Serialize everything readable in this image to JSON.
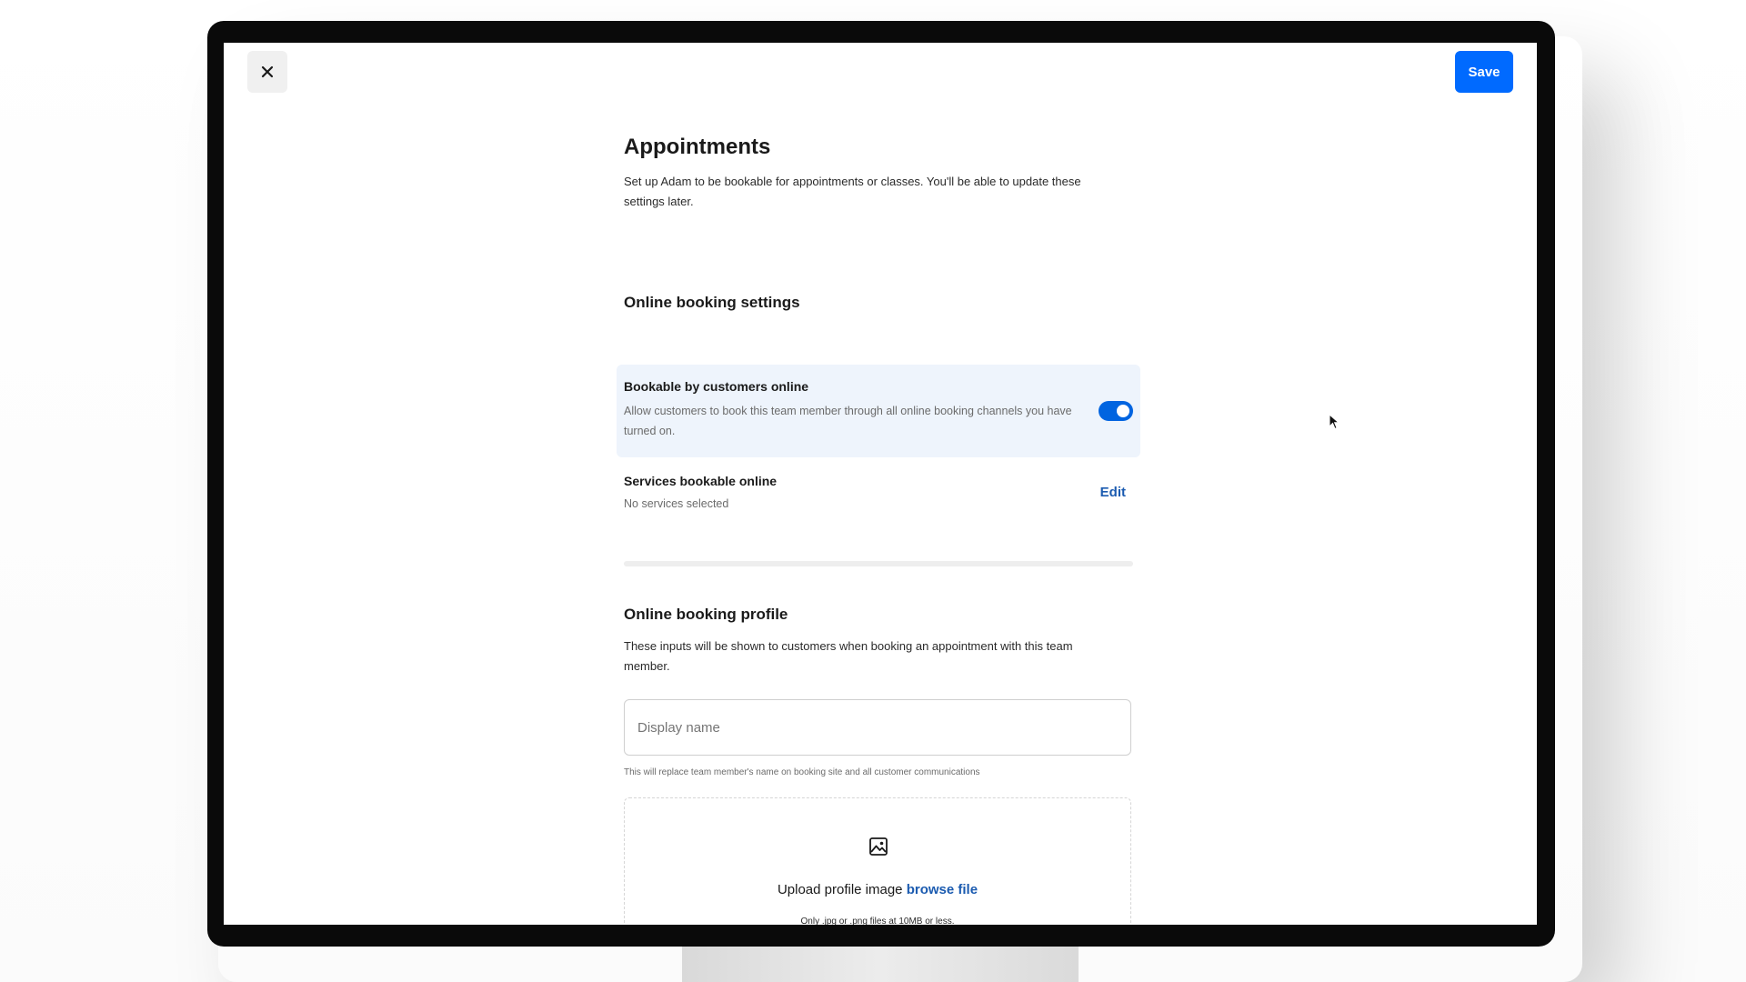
{
  "header": {
    "close_icon": "close-icon",
    "save_label": "Save",
    "save_color": "#006aff"
  },
  "page": {
    "title": "Appointments",
    "description": "Set up Adam to be bookable for appointments or classes. You'll be able to update these settings later."
  },
  "online_booking_settings": {
    "title": "Online booking settings",
    "bookable_online": {
      "title": "Bookable by customers online",
      "description": "Allow customers to book this team member through all online booking channels you have turned on.",
      "enabled": true,
      "toggle_color": "#0064e0"
    },
    "services": {
      "title": "Services bookable online",
      "subtitle": "No services selected",
      "edit_label": "Edit"
    }
  },
  "online_booking_profile": {
    "title": "Online booking profile",
    "description": "These inputs will be shown to customers when booking an appointment with this team member.",
    "display_name": {
      "placeholder": "Display name",
      "value": "",
      "helper": "This will replace team member's name on booking site and all customer communications"
    },
    "upload": {
      "icon": "image-icon",
      "label": "Upload profile image",
      "link": "browse file",
      "note": "Only .jpg or .png files at 10MB or less."
    }
  }
}
